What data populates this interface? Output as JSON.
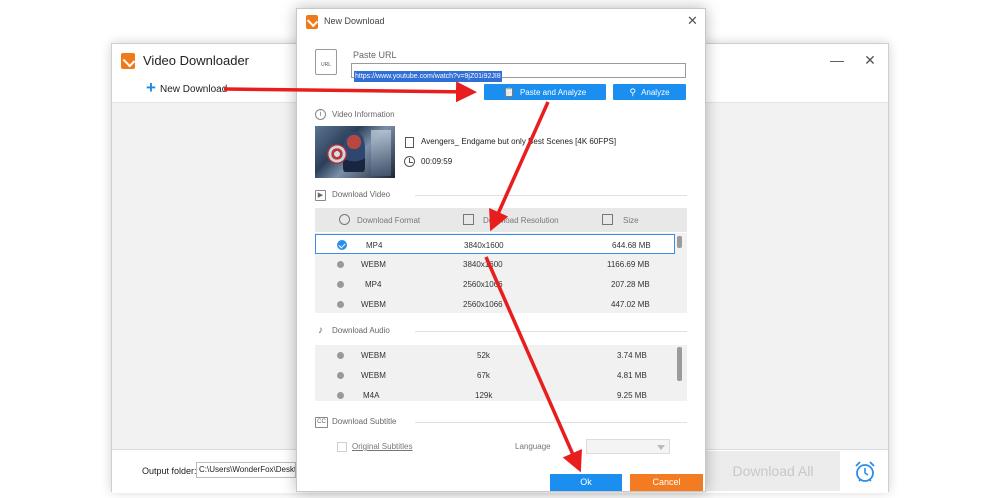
{
  "main_window": {
    "title": "Video Downloader",
    "minimize_glyph": "—",
    "close_glyph": "✕",
    "new_download_icon": "+",
    "new_download_label": "New Download",
    "output_folder_label": "Output folder:",
    "output_folder_value": "C:\\Users\\WonderFox\\Desktop",
    "download_all_label": "Download All",
    "alarm_icon": "alarm-clock-icon"
  },
  "dialog": {
    "title": "New Download",
    "close_glyph": "✕",
    "paste_url": {
      "label": "Paste URL",
      "icon_text": "URL",
      "url_value": "https://www.youtube.com/watch?v=9jZ01i92JI8",
      "paste_analyze_label": "Paste and Analyze",
      "analyze_label": "Analyze"
    },
    "video_information": {
      "label": "Video Information",
      "title": "Avengers_ Endgame but only Best Scenes [4K 60FPS]",
      "duration": "00:09:59"
    },
    "download_video": {
      "label": "Download Video",
      "headers": [
        "Download Format",
        "Download Resolution",
        "Size"
      ],
      "rows": [
        {
          "format": "MP4",
          "resolution": "3840x1600",
          "size": "644.68 MB",
          "selected": true
        },
        {
          "format": "WEBM",
          "resolution": "3840x1600",
          "size": "1166.69 MB",
          "selected": false
        },
        {
          "format": "MP4",
          "resolution": "2560x1066",
          "size": "207.28 MB",
          "selected": false
        },
        {
          "format": "WEBM",
          "resolution": "2560x1066",
          "size": "447.02 MB",
          "selected": false
        }
      ]
    },
    "download_audio": {
      "label": "Download Audio",
      "rows": [
        {
          "format": "WEBM",
          "bitrate": "52k",
          "size": "3.74 MB"
        },
        {
          "format": "WEBM",
          "bitrate": "67k",
          "size": "4.81 MB"
        },
        {
          "format": "M4A",
          "bitrate": "129k",
          "size": "9.25 MB"
        }
      ]
    },
    "download_subtitle": {
      "label": "Download Subtitle",
      "icon_text": "CC",
      "original_subtitles_label": "Original Subtitles",
      "language_label": "Language"
    },
    "ok_label": "Ok",
    "cancel_label": "Cancel"
  },
  "colors": {
    "accent_blue": "#1b8ff0",
    "cancel_orange": "#f37b21",
    "arrow_red": "#e81e1e",
    "logo_orange": "#f07a1a"
  }
}
